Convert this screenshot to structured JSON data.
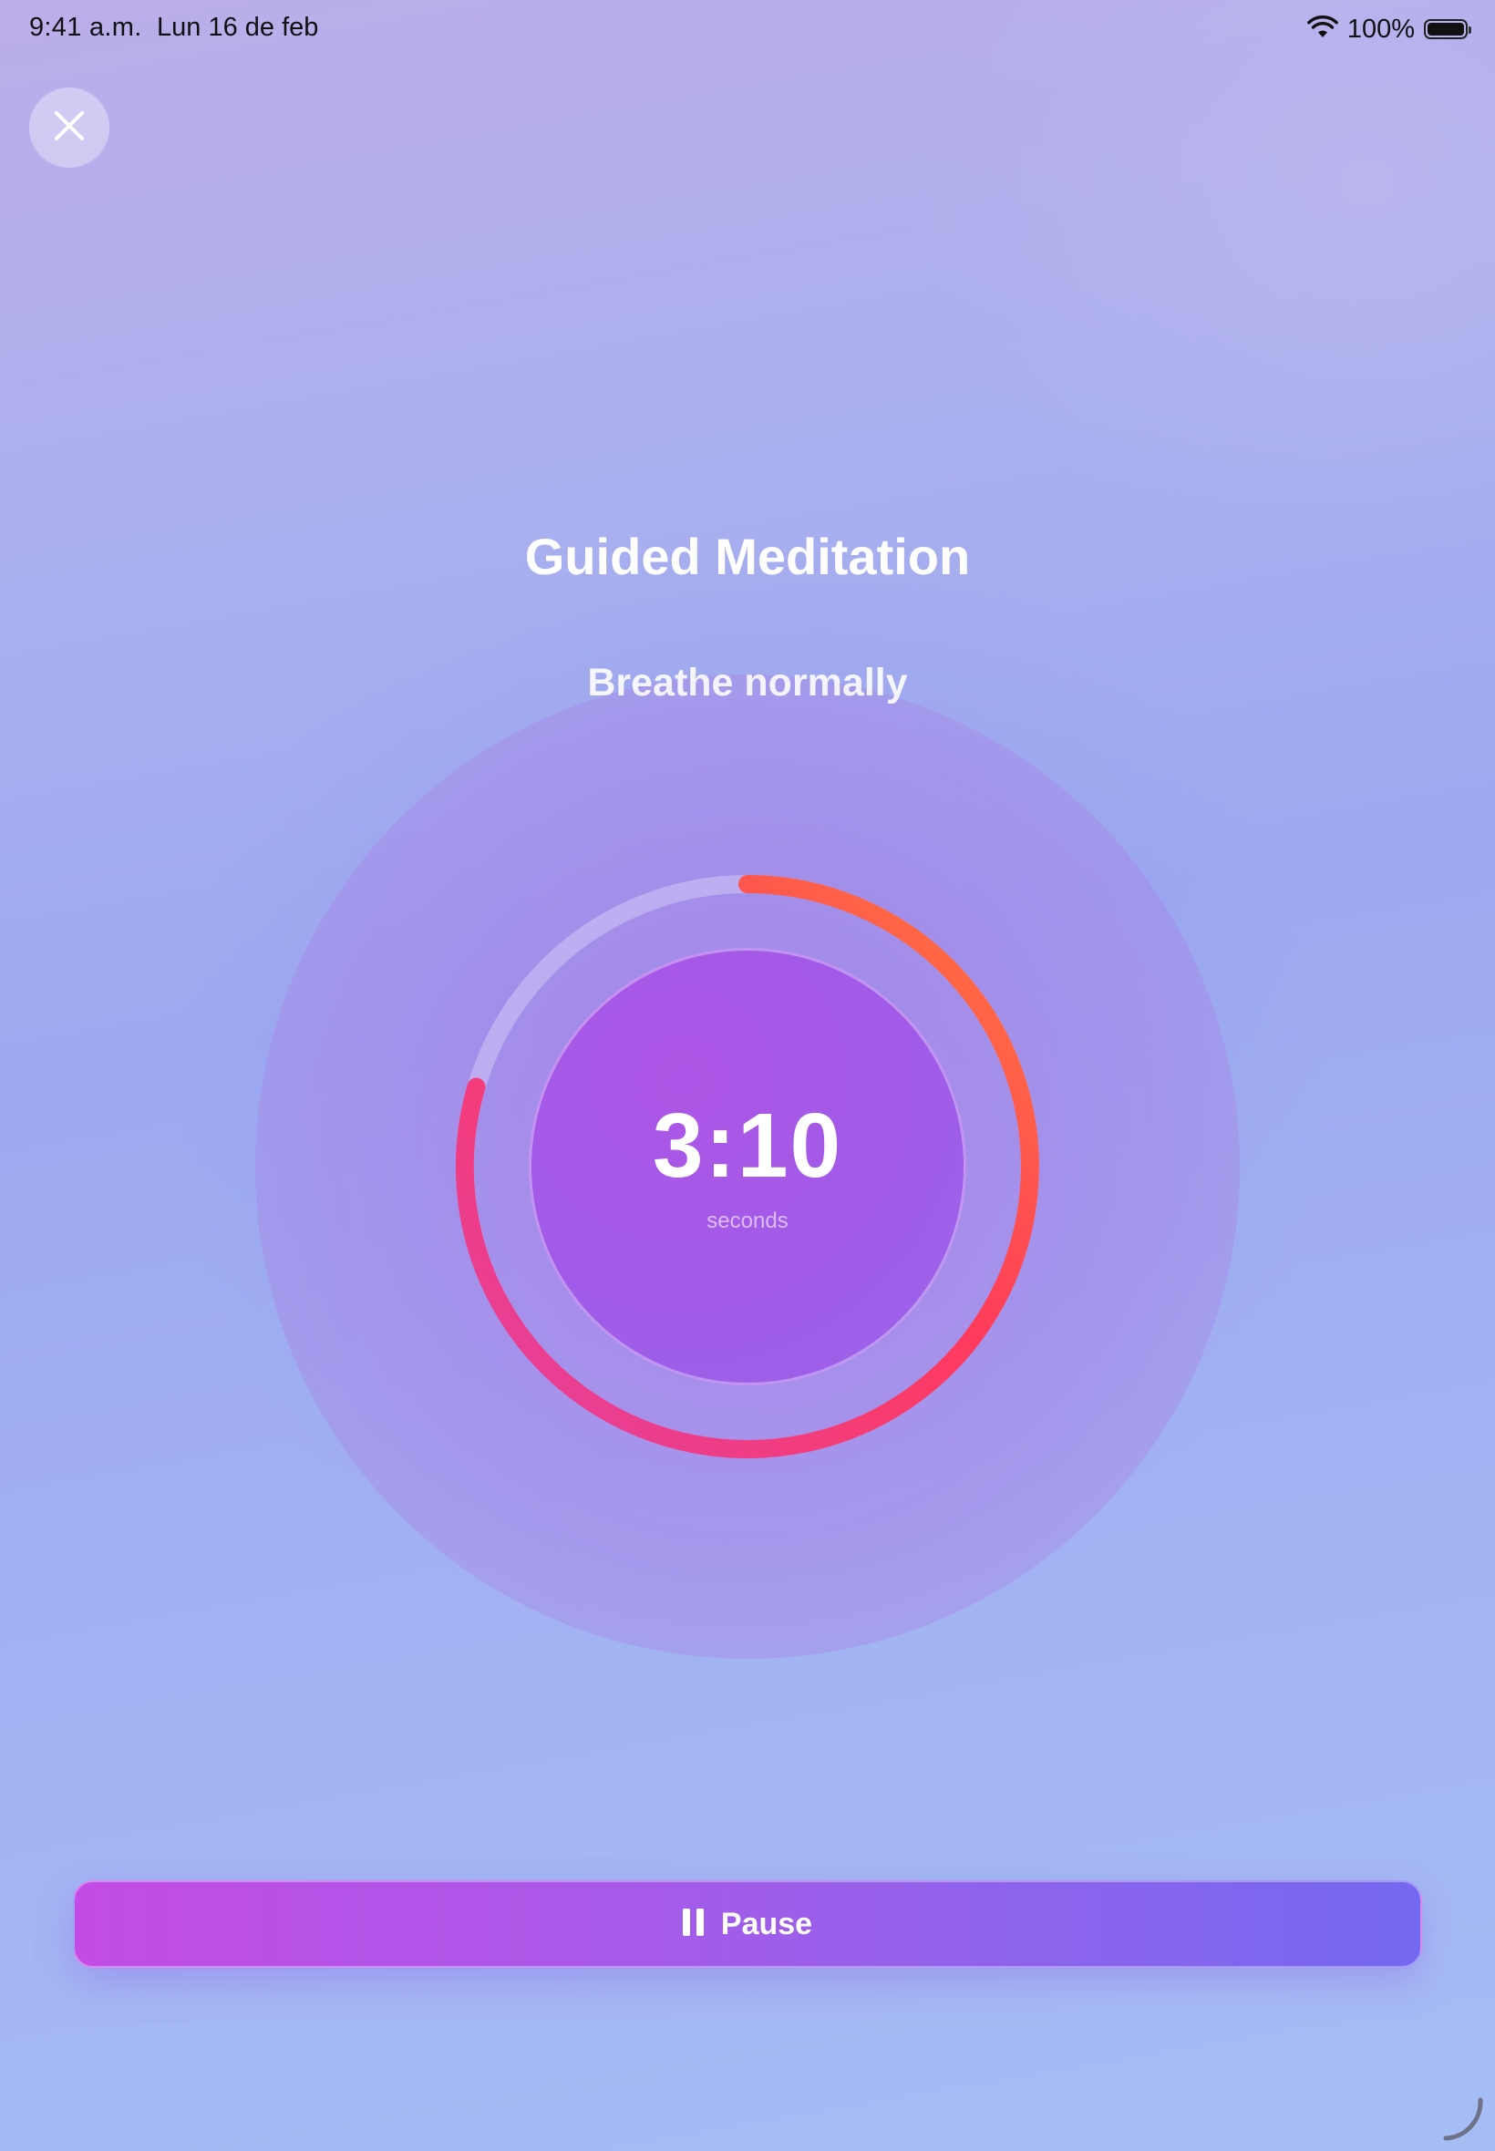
{
  "status_bar": {
    "time": "9:41 a.m.",
    "date": "Lun 16 de feb",
    "battery": "100%"
  },
  "header": {
    "title": "Guided Meditation",
    "subtitle": "Breathe normally"
  },
  "timer": {
    "value": "3:10",
    "unit": "seconds"
  },
  "controls": {
    "pause_label": "Pause"
  },
  "colors": {
    "progress_start": "#e23fa6",
    "progress_mid": "#ff3a5c",
    "progress_end": "#ff7a3a",
    "button_start": "#c44ce6",
    "button_end": "#7568f0"
  },
  "icons": {
    "close": "close-icon",
    "pause": "pause-icon",
    "wifi": "wifi-icon",
    "battery": "battery-icon"
  }
}
